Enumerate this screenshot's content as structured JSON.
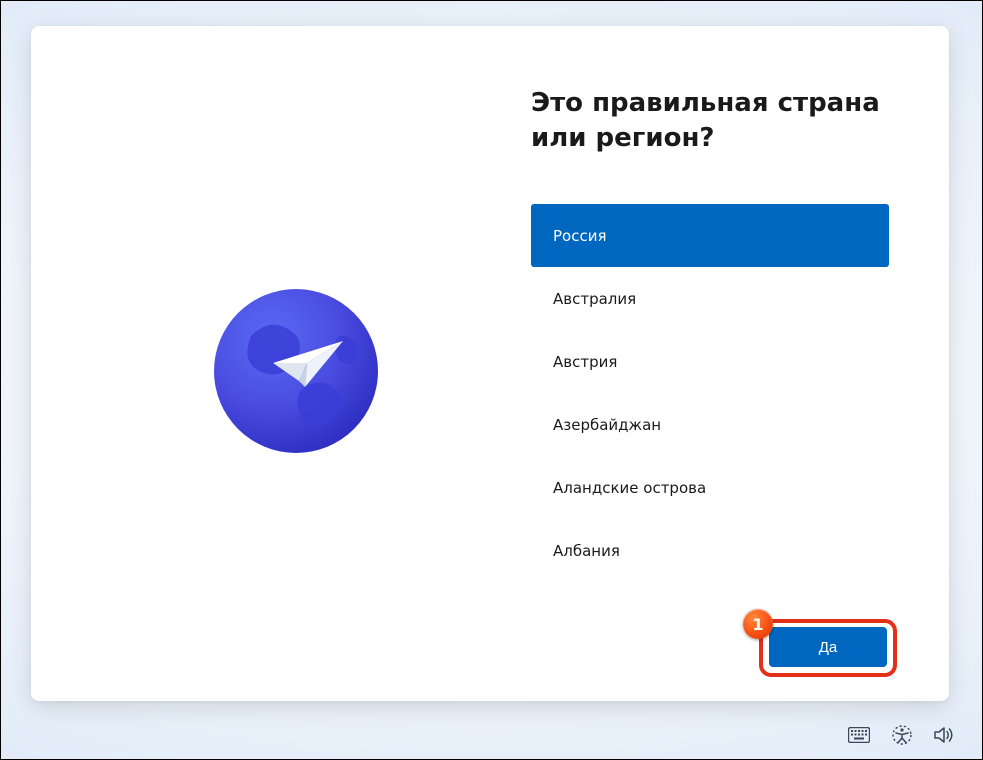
{
  "heading": "Это правильная страна или регион?",
  "countries": [
    {
      "name": "Россия",
      "selected": true
    },
    {
      "name": "Австралия",
      "selected": false
    },
    {
      "name": "Австрия",
      "selected": false
    },
    {
      "name": "Азербайджан",
      "selected": false
    },
    {
      "name": "Аландские острова",
      "selected": false
    },
    {
      "name": "Албания",
      "selected": false
    }
  ],
  "confirm_label": "Да",
  "annotation_number": "1",
  "colors": {
    "accent": "#0067c0",
    "annotation": "#e33019"
  }
}
